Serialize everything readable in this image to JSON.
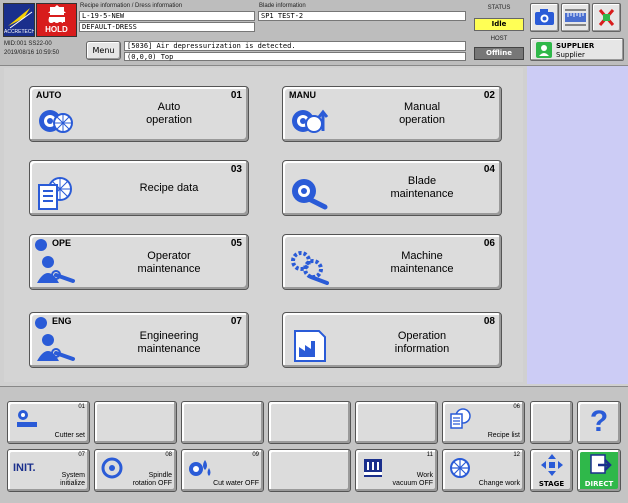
{
  "header": {
    "logo_text": "ACCRETECH",
    "cut_hold_label": "CUT HOLD",
    "recipe_caption": "Recipe information / Dress information",
    "recipe_name": "L-19-5-NEW",
    "dress_name": "DEFAULT-DRESS",
    "blade_caption": "Blade information",
    "blade_name": "SP1 TEST-2",
    "machine_id": "MID:001  SS22-00",
    "datetime": "2019/08/16 10:59:50",
    "menu_label": "Menu",
    "message": "[5036] Air depressurization is detected.",
    "position": "(0,0,0) Top",
    "status_caption": "STATUS",
    "status_value": "Idle",
    "host_caption": "HOST",
    "host_value": "Offline",
    "supplier_line1": "SUPPLIER",
    "supplier_line2": "Supplier"
  },
  "menu": [
    {
      "num": "01",
      "tag": "AUTO",
      "label": "Auto\noperation"
    },
    {
      "num": "02",
      "tag": "MANU",
      "label": "Manual\noperation"
    },
    {
      "num": "03",
      "tag": "",
      "label": "Recipe data"
    },
    {
      "num": "04",
      "tag": "",
      "label": "Blade\nmaintenance"
    },
    {
      "num": "05",
      "tag": "OPE",
      "label": "Operator\nmaintenance"
    },
    {
      "num": "06",
      "tag": "",
      "label": "Machine\nmaintenance"
    },
    {
      "num": "07",
      "tag": "ENG",
      "label": "Engineering\nmaintenance"
    },
    {
      "num": "08",
      "tag": "",
      "label": "Operation\ninformation"
    }
  ],
  "bottom": {
    "cutter_set": {
      "num": "01",
      "label": "Cutter set"
    },
    "recipe_list": {
      "num": "06",
      "label": "Recipe list"
    },
    "system_init": {
      "num": "07",
      "label": "System\ninitialize",
      "icon_text": "INIT."
    },
    "spindle_off": {
      "num": "08",
      "label": "Spindle\nrotation OFF"
    },
    "cut_water_off": {
      "num": "09",
      "label": "Cut water OFF"
    },
    "work_vacuum_off": {
      "num": "11",
      "label": "Work\nvacuum OFF"
    },
    "change_work": {
      "num": "12",
      "label": "Change work"
    },
    "stage_label": "STAGE",
    "direct_label": "DIRECT",
    "help_label": "?"
  },
  "colors": {
    "accent_blue": "#2a5bd7",
    "side_panel": "#ccccf5",
    "idle": "#ffff55",
    "cut_hold": "#d81c1c",
    "direct": "#2fb84a"
  }
}
